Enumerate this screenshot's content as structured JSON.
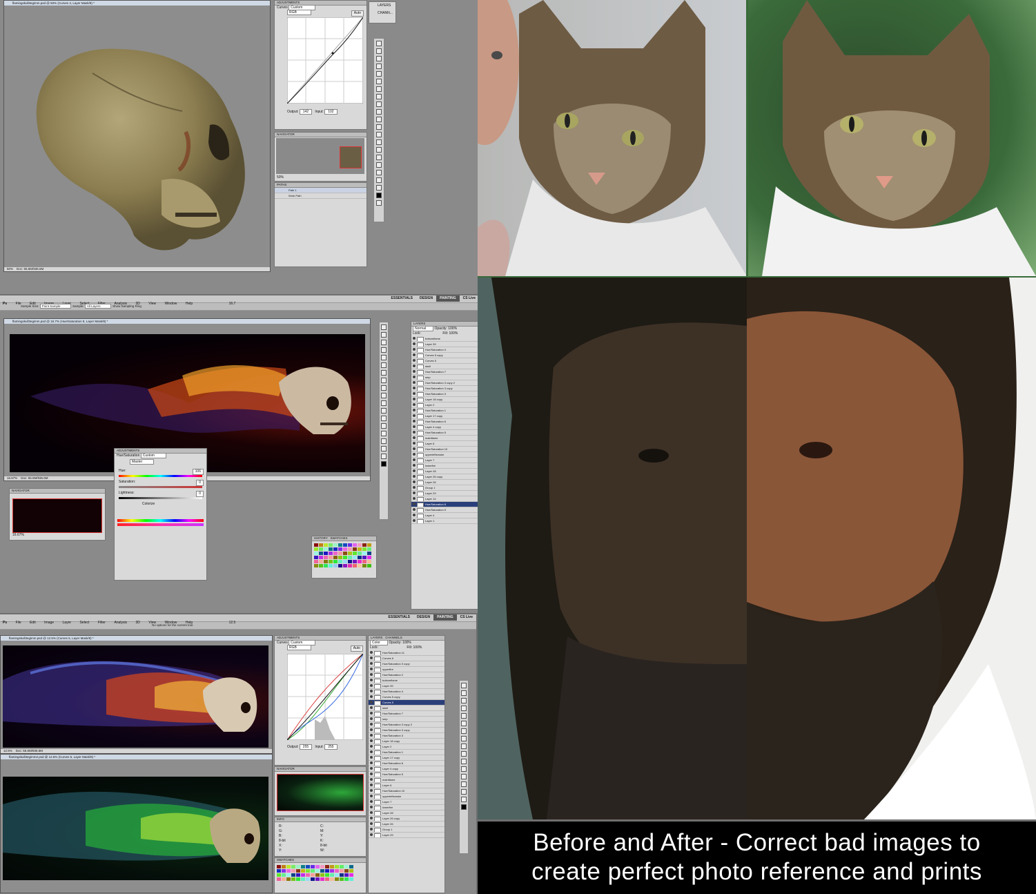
{
  "top_window": {
    "doc_title": "flamingskull3egimm.psd @ 50% (Curves 4, Layer Mask/8) *",
    "zoom": "50%",
    "doc_info": "Doc: 55.6M/936.6M",
    "adjustments_tab": "ADJUSTMENTS",
    "curves_label": "Curves",
    "curves_preset": "Custom",
    "channel": "RGB",
    "auto_label": "Auto",
    "output_label": "Output:",
    "output_value": "142",
    "input_label": "Input:",
    "input_value": "102",
    "navigator_tab": "NAVIGATOR",
    "nav_zoom": "50%",
    "paths_tab": "PATHS",
    "paths": [
      "Path 1",
      "Work Path"
    ],
    "layers_tab": "LAYERS",
    "channels_tab": "CHANN..."
  },
  "middle_window": {
    "menu": [
      "File",
      "Edit",
      "Image",
      "Layer",
      "Select",
      "Filter",
      "Analysis",
      "3D",
      "View",
      "Window",
      "Help"
    ],
    "workspaces": [
      "ESSENTIALS",
      "DESIGN",
      "PAINTING"
    ],
    "cs_live": "CS Live",
    "zoom_menu": "16.7",
    "options": {
      "sample_size_label": "Sample Size:",
      "sample_size": "Point Sample",
      "sample_label": "Sample:",
      "sample": "All Layers",
      "show_ring": "Show Sampling Ring"
    },
    "doc_title": "flamingskull3egimm.psd @ 16.7% (Hue/Saturation 8, Layer Mask/8) *",
    "zoom": "16.67%",
    "doc_info": "Doc: 55.6M/936.6M",
    "navigator_tab": "NAVIGATOR",
    "nav_zoom": "16.67%",
    "adjustments": {
      "tab": "ADJUSTMENTS",
      "title": "Hue/Saturation",
      "preset": "Custom",
      "channel": "Master",
      "hue_label": "Hue:",
      "hue_value": "106",
      "saturation_label": "Saturation:",
      "saturation_value": "0",
      "lightness_label": "Lightness:",
      "lightness_value": "0",
      "colorize_label": "Colorize"
    },
    "swatches": {
      "history_tab": "HISTORY",
      "swatches_tab": "SWATCHES"
    },
    "layers": {
      "tab": "LAYERS",
      "blend": "Normal",
      "opacity_label": "Opacity:",
      "opacity": "100%",
      "fill_label": "Fill:",
      "fill": "100%",
      "lock_label": "Lock:",
      "items": [
        "bottomflame",
        "Layer 39",
        "Hue/Saturation 4",
        "Curves 5 copy",
        "Curves 5",
        "skull",
        "Hue/Saturation 7",
        "smp",
        "Hue/Saturation 3 copy 2",
        "Hue/Saturation 3 copy",
        "Hue/Saturation 3",
        "Layer 18 copy",
        "Layer 2",
        "Hue/Saturation 1",
        "Layer 17 copy",
        "Hue/Saturation 6",
        "Layer 4 copy",
        "Hue/Saturation 5",
        "mainflame",
        "Layer 6",
        "Hue/Saturation 10",
        "upperleftsmoke",
        "Layer 7",
        "lowerfire",
        "Layer 28",
        "Layer 26 copy",
        "Layer 26",
        "Group 1",
        "Layer 29",
        "Layer 14",
        "Hue/Saturation 8",
        "Hue/Saturation 9",
        "Layer 4",
        "Layer 1"
      ]
    }
  },
  "bottom_window": {
    "menu": [
      "File",
      "Edit",
      "Image",
      "Layer",
      "Select",
      "Filter",
      "Analysis",
      "3D",
      "View",
      "Window",
      "Help"
    ],
    "workspaces": [
      "ESSENTIALS",
      "DESIGN",
      "PAINTING"
    ],
    "cs_live": "CS Live",
    "zoom_menu": "12.5",
    "options_text": "No options for the current tool.",
    "doc1_title": "flamingskull3egimm.psd @ 12.5% (Curves 5, Layer Mask/8) *",
    "doc1_zoom": "12.5%",
    "doc1_info": "Doc: 55.6M/936.6M",
    "doc2_title": "flamingskull3egimm2.psd @ 12.5% (Curves 5, Layer Mask/8) *",
    "adjustments_tab": "ADJUSTMENTS",
    "curves_label": "Curves",
    "curves_preset": "Custom",
    "channel": "RGB",
    "auto_label": "Auto",
    "output_label": "Output:",
    "output_value": "255",
    "input_label": "Input:",
    "input_value": "255",
    "navigator_tab": "NAVIGATOR",
    "info_tab": "INFO",
    "info_labels": [
      "R:",
      "G:",
      "B:",
      "8-bit",
      "X:",
      "Y:",
      "C:",
      "M:",
      "Y:",
      "K:",
      "8-bit",
      "W:",
      "H:"
    ],
    "swatches_tab": "SWATCHES",
    "layers": {
      "tab": "LAYERS",
      "channels_tab": "CHANNELS",
      "blend": "Color",
      "opacity_label": "Opacity:",
      "opacity": "100%",
      "fill_label": "Fill:",
      "fill": "100%",
      "lock_label": "Lock:",
      "items": [
        "Hue/Saturation 11",
        "Curves 6",
        "Hue/Saturation 3 copy",
        "upperfire",
        "Hue/Saturation 2",
        "bottomflame",
        "Layer 39",
        "Hue/Saturation 4",
        "Curves 5 copy",
        "Curves 5",
        "skull",
        "Hue/Saturation 7",
        "smp",
        "Hue/Saturation 3 copy 2",
        "Hue/Saturation 3 copy",
        "Hue/Saturation 3",
        "Layer 18 copy",
        "Layer 2",
        "Hue/Saturation 1",
        "Layer 17 copy",
        "Hue/Saturation 6",
        "Layer 4 copy",
        "Hue/Saturation 5",
        "mainflame",
        "Layer 6",
        "Hue/Saturation 10",
        "upperleftsmoke",
        "Layer 7",
        "lowerfire",
        "Layer 28",
        "Layer 26 copy",
        "Layer 26",
        "Group 1",
        "Layer 29"
      ]
    }
  },
  "caption": {
    "line1": "Before and After - Correct bad images to",
    "line2": "create perfect photo reference and prints"
  },
  "colors": {
    "background": "#6f6f6f",
    "accent_selection": "#2a3f7a",
    "caption_bg": "#000000",
    "caption_text": "#ffffff"
  }
}
